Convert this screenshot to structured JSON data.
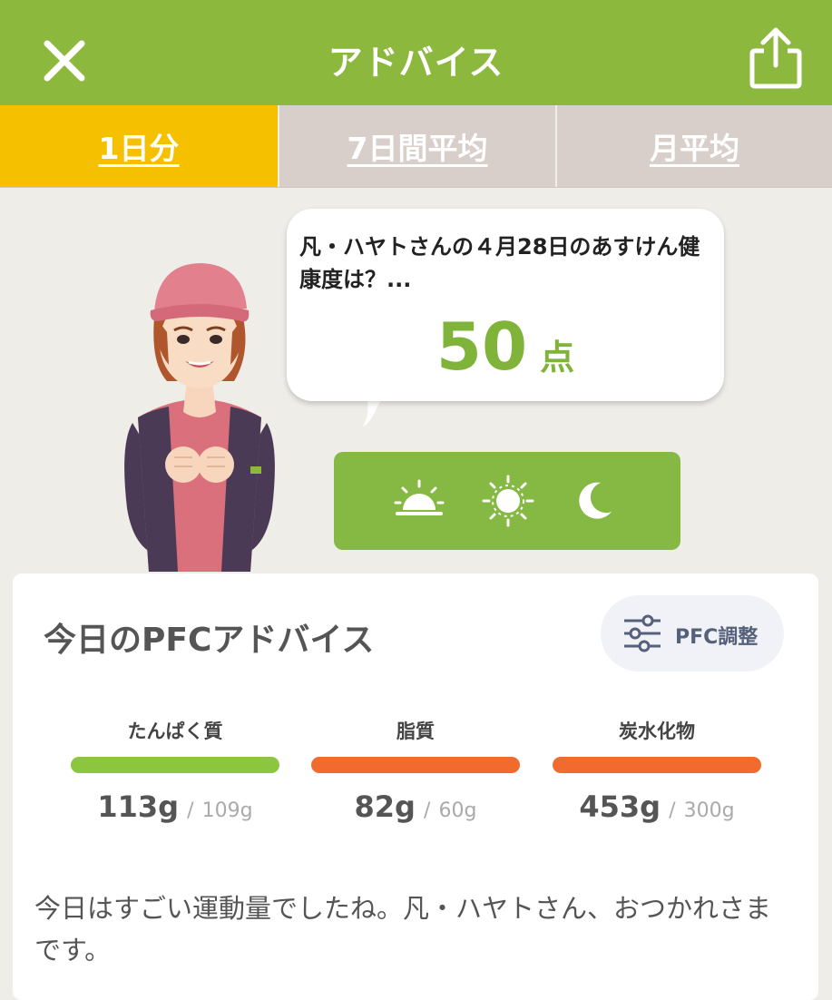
{
  "header": {
    "title": "アドバイス",
    "close_icon": "close-icon",
    "share_icon": "share-icon"
  },
  "tabs": [
    {
      "label": "1日分",
      "active": true
    },
    {
      "label": "7日間平均",
      "active": false
    },
    {
      "label": "月平均",
      "active": false
    }
  ],
  "bubble": {
    "message": "凡・ハヤトさんの４月28日のあすけん健康度は？...",
    "score": "50",
    "unit": "点"
  },
  "meals": [
    {
      "icon": "sunrise-icon"
    },
    {
      "icon": "sun-icon"
    },
    {
      "icon": "moon-icon"
    }
  ],
  "pfc": {
    "title": "今日のPFCアドバイス",
    "adjust_label": "PFC調整",
    "nutrients": [
      {
        "name": "たんぱく質",
        "actual": "113g",
        "separator": "/",
        "target": "109g",
        "color": "#8cc63f"
      },
      {
        "name": "脂質",
        "actual": "82g",
        "separator": "/",
        "target": "60g",
        "color": "#f26b2e"
      },
      {
        "name": "炭水化物",
        "actual": "453g",
        "separator": "/",
        "target": "300g",
        "color": "#f26b2e"
      }
    ],
    "advice": "今日はすごい運動量でしたね。凡・ハヤトさん、おつかれさまです。"
  },
  "colors": {
    "brand": "#8cb83e",
    "tab_active": "#f5c000",
    "tab_inactive": "#d8ceca",
    "score": "#7fb33a"
  }
}
